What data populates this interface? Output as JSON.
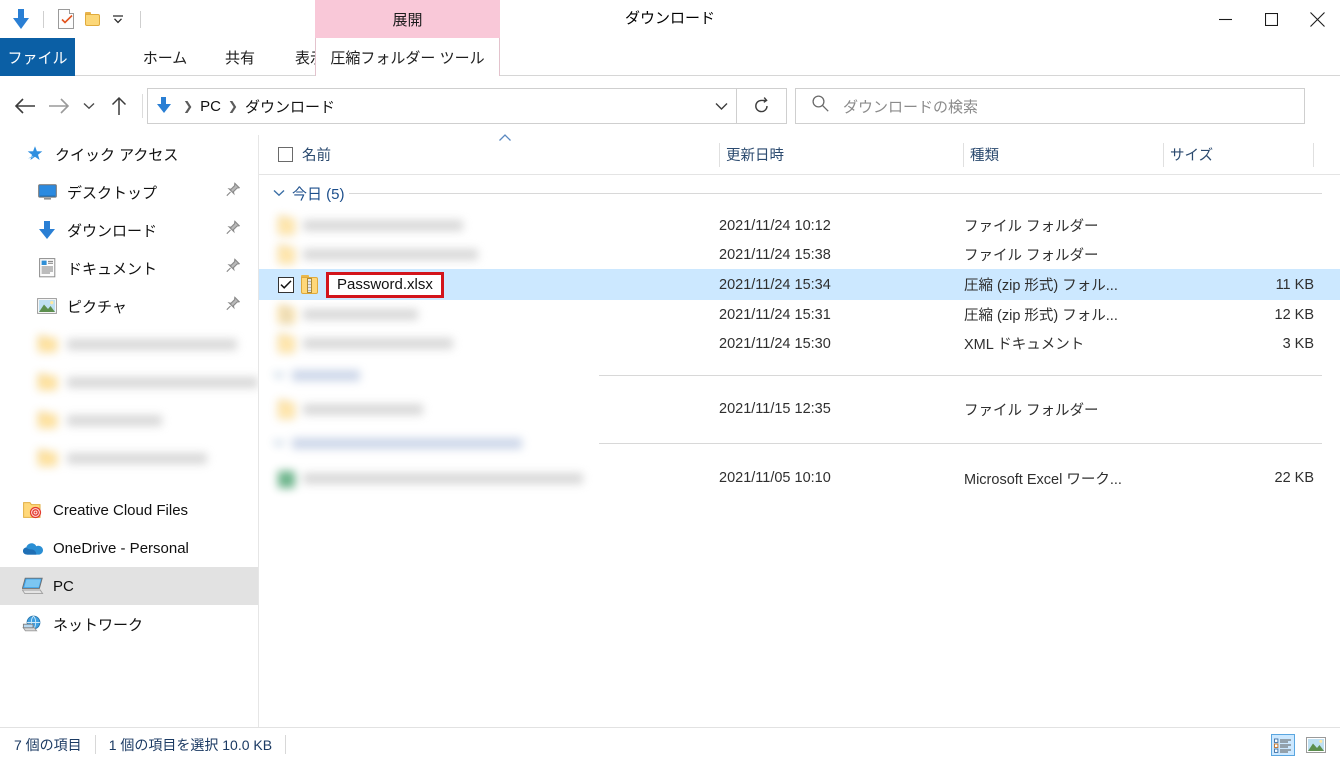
{
  "window": {
    "title": "ダウンロード",
    "contextual_tab_header": "展開",
    "quick_access": {
      "downloads_icon": "download-arrow-icon",
      "properties_icon": "properties-document-icon",
      "new_folder_icon": "new-folder-icon",
      "customize_chevron": "chevron-down-icon"
    },
    "controls": {
      "minimize": "minimize-icon",
      "maximize": "maximize-icon",
      "close": "close-icon"
    }
  },
  "ribbon": {
    "tabs": [
      {
        "label": "ファイル",
        "active": true
      },
      {
        "label": "ホーム",
        "active": false
      },
      {
        "label": "共有",
        "active": false
      },
      {
        "label": "表示",
        "active": false
      }
    ],
    "contextual_tab": "圧縮フォルダー ツール",
    "collapse_icon": "chevron-down-icon",
    "help_label": "?"
  },
  "address_bar": {
    "back_icon": "arrow-left-icon",
    "forward_icon": "arrow-right-icon",
    "recent_icon": "chevron-down-icon",
    "up_icon": "arrow-up-icon",
    "breadcrumb_icon": "download-arrow-icon",
    "breadcrumb": [
      "PC",
      "ダウンロード"
    ],
    "dropdown_icon": "chevron-down-icon",
    "refresh_icon": "refresh-icon"
  },
  "search": {
    "icon": "search-icon",
    "placeholder": "ダウンロードの検索",
    "value": ""
  },
  "sidebar": {
    "items": [
      {
        "label": "クイック アクセス",
        "icon": "star-pin-icon",
        "indent": false,
        "pin": false,
        "selected": false,
        "blurred": false
      },
      {
        "label": "デスクトップ",
        "icon": "desktop-icon",
        "indent": true,
        "pin": true,
        "selected": false,
        "blurred": false
      },
      {
        "label": "ダウンロード",
        "icon": "download-arrow-icon",
        "indent": true,
        "pin": true,
        "selected": false,
        "blurred": false
      },
      {
        "label": "ドキュメント",
        "icon": "documents-icon",
        "indent": true,
        "pin": true,
        "selected": false,
        "blurred": false
      },
      {
        "label": "ピクチャ",
        "icon": "pictures-icon",
        "indent": true,
        "pin": true,
        "selected": false,
        "blurred": false
      },
      {
        "label": "",
        "icon": "folder-icon",
        "indent": true,
        "pin": false,
        "selected": false,
        "blurred": true,
        "blur_width": 170
      },
      {
        "label": "",
        "icon": "folder-icon",
        "indent": true,
        "pin": false,
        "selected": false,
        "blurred": true,
        "blur_width": 195
      },
      {
        "label": "",
        "icon": "folder-icon",
        "indent": true,
        "pin": false,
        "selected": false,
        "blurred": true,
        "blur_width": 95
      },
      {
        "label": "",
        "icon": "folder-icon",
        "indent": true,
        "pin": false,
        "selected": false,
        "blurred": true,
        "blur_width": 140
      },
      {
        "label": "Creative Cloud Files",
        "icon": "creative-cloud-folder-icon",
        "indent": false,
        "pin": false,
        "selected": false,
        "blurred": false
      },
      {
        "label": "OneDrive - Personal",
        "icon": "onedrive-cloud-icon",
        "indent": false,
        "pin": false,
        "selected": false,
        "blurred": false
      },
      {
        "label": "PC",
        "icon": "pc-icon",
        "indent": false,
        "pin": false,
        "selected": true,
        "blurred": false
      },
      {
        "label": "ネットワーク",
        "icon": "network-icon",
        "indent": false,
        "pin": false,
        "selected": false,
        "blurred": false
      }
    ]
  },
  "file_list": {
    "columns": [
      {
        "label": "名前",
        "key": "name"
      },
      {
        "label": "更新日時",
        "key": "date"
      },
      {
        "label": "種類",
        "key": "type"
      },
      {
        "label": "サイズ",
        "key": "size"
      }
    ],
    "sort_column": "名前",
    "sort_direction": "asc",
    "header_checkbox_checked": false,
    "groups": [
      {
        "label": "今日 (5)",
        "blurred": false,
        "expanded": true,
        "rows": [
          {
            "name": "",
            "blurred": true,
            "blur_width": 160,
            "icon": "folder-icon",
            "date": "2021/11/24 10:12",
            "type": "ファイル フォルダー",
            "size": "",
            "selected": false,
            "checked": false
          },
          {
            "name": "",
            "blurred": true,
            "blur_width": 175,
            "icon": "folder-icon",
            "date": "2021/11/24 15:38",
            "type": "ファイル フォルダー",
            "size": "",
            "selected": false,
            "checked": false
          },
          {
            "name": "Password.xlsx",
            "blurred": false,
            "icon": "zip-folder-icon",
            "date": "2021/11/24 15:34",
            "type": "圧縮 (zip 形式) フォル...",
            "size": "11 KB",
            "selected": true,
            "checked": true,
            "highlight_box": true
          },
          {
            "name": "",
            "blurred": true,
            "blur_width": 115,
            "icon": "zip-folder-icon",
            "date": "2021/11/24 15:31",
            "type": "圧縮 (zip 形式) フォル...",
            "size": "12 KB",
            "selected": false,
            "checked": false
          },
          {
            "name": "",
            "blurred": true,
            "blur_width": 150,
            "icon": "xml-icon",
            "date": "2021/11/24 15:30",
            "type": "XML ドキュメント",
            "size": "3 KB",
            "selected": false,
            "checked": false
          }
        ]
      },
      {
        "label": "",
        "blurred": true,
        "blur_width": 68,
        "expanded": true,
        "rows": [
          {
            "name": "",
            "blurred": true,
            "blur_width": 120,
            "icon": "folder-icon",
            "date": "2021/11/15 12:35",
            "type": "ファイル フォルダー",
            "size": "",
            "selected": false,
            "checked": false
          }
        ]
      },
      {
        "label": "",
        "blurred": true,
        "blur_width": 230,
        "expanded": true,
        "rows": [
          {
            "name": "",
            "blurred": true,
            "blur_width": 280,
            "icon": "excel-icon",
            "date": "2021/11/05 10:10",
            "type": "Microsoft Excel ワーク...",
            "size": "22 KB",
            "selected": false,
            "checked": false
          }
        ]
      }
    ]
  },
  "status_bar": {
    "item_count": "7 個の項目",
    "selection": "1 個の項目を選択  10.0 KB",
    "details_view_icon": "details-view-icon",
    "large_icons_view_icon": "large-icons-view-icon",
    "active_view": "details"
  },
  "colors": {
    "accent": "#0b5fa5",
    "selection": "#cce8ff",
    "contextual_tab": "#f9c8d8",
    "annotation_red": "#d3141b",
    "group_header_text": "#1d4f8c"
  }
}
